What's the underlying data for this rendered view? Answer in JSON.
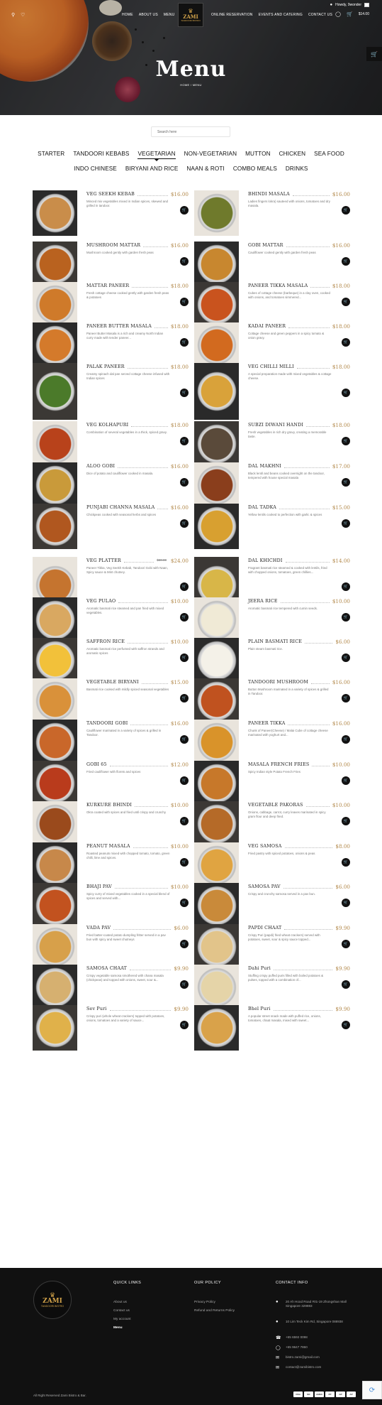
{
  "topbar": {
    "greeting": "Howdy, 9wonder"
  },
  "nav": {
    "left": [
      "HOME",
      "ABOUT US",
      "MENU"
    ],
    "right": [
      "ONLINE RESERVATION",
      "EVENTS AND CATERING",
      "CONTACT US"
    ],
    "cart_total": "$14.00",
    "cart_count": "0"
  },
  "logo": {
    "text": "ZAMI",
    "sub": "TANDOORI BISTRO"
  },
  "hero": {
    "title": "Menu",
    "breadcrumb": "HOME  /  MENU"
  },
  "search": {
    "placeholder": "Search here"
  },
  "tabs_row1": [
    "STARTER",
    "TANDOORI KEBABS",
    "VEGETARIAN",
    "NON-VEGETARIAN",
    "MUTTON",
    "CHICKEN",
    "SEA FOOD"
  ],
  "tabs_row2": [
    "INDO CHINESE",
    "BIRYANI AND RICE",
    "NAAN & ROTI",
    "COMBO MEALS",
    "DRINKS"
  ],
  "active_tab": "VEGETARIAN",
  "items": [
    {
      "name": "VEG SEEKH KEBAB",
      "price": "$16.00",
      "desc": "Minced mix vegetables mixed in Indian spices, skewed and grilled in tandoor.",
      "food": "#c98d4a"
    },
    {
      "name": "BHINDI MASALA",
      "price": "$16.00",
      "desc": "Ladies fingers lokra) sauteed with onions, tomatoes and dry masala.",
      "food": "#6f7a2c"
    },
    {
      "name": "MUSHROOM MATTAR",
      "price": "$16.00",
      "desc": "Mushroom cooked gently with garden fresh peas",
      "food": "#b9621f"
    },
    {
      "name": "GOBI MATTAR",
      "price": "$16.00",
      "desc": "Cauliflower cooked gently with garden fresh peas",
      "food": "#c8872f"
    },
    {
      "name": "MATTAR PANEER",
      "price": "$18.00",
      "desc": "Fresh cottage cheese cooked gently with garden fresh peas & potatoes",
      "food": "#cf7a2a"
    },
    {
      "name": "PANEER TIKKA MASALA",
      "price": "$18.00",
      "desc": "Cubes of cottage cheese (barbeque) in a clay oven, cooked with onions, and tomatoes simmered...",
      "food": "#c9531e"
    },
    {
      "name": "PANEER BUTTER MASALA",
      "price": "$18.00",
      "desc": "Paneer Butter Masala is a rich and creamy North Indian curry made with tender paneer...",
      "food": "#d47a2b"
    },
    {
      "name": "KADAI PANEER",
      "price": "$18.00",
      "desc": "Cottage cheese and green peppers in a spicy tomato & onion gravy.",
      "food": "#d26a1f"
    },
    {
      "name": "PALAK PANEER",
      "price": "$18.00",
      "desc": "Creamy spinach dal pan served cottage cheese infused with Indian spices",
      "food": "#4b7a2a"
    },
    {
      "name": "VEG CHILLI MILLI",
      "price": "$18.00",
      "desc": "A special preparation made with mixed vegetables & cottage cheese.",
      "food": "#d9a23a"
    },
    {
      "name": "VEG KOLHAPURI",
      "price": "$18.00",
      "desc": "Combination of several vegetables in a thick, spiced gravy.",
      "food": "#b8421b"
    },
    {
      "name": "SUBZI DIWANI HANDI",
      "price": "$18.00",
      "desc": "Fresh vegetables in rich dry gravy, creating a memorable taste.",
      "food": "#5a4a3a"
    },
    {
      "name": "ALOO GOBI",
      "price": "$16.00",
      "desc": "Dice of potato and cauliflower cooked in masala.",
      "food": "#c99a3a"
    },
    {
      "name": "DAL MAKHNI",
      "price": "$17.00",
      "desc": "Black lentil and beans cooked overnight on the tandoor, tempered with house special masala",
      "food": "#8a3e1c"
    },
    {
      "name": "PUNJABI CHANNA MASALA",
      "price": "$16.00",
      "desc": "Chickpeas cooked with seasonal herbs and spices",
      "food": "#b0571f"
    },
    {
      "name": "DAL TADKA",
      "price": "$15.00",
      "desc": "Yellow lentils cooked to perfection with garlic & spices",
      "food": "#d8a030"
    },
    {
      "name": "VEG PLATTER",
      "price": "$24.00",
      "old": "$30.00",
      "desc": "Paneer Tikka, Veg Seekh Kebab, Tandoori Gobi with Naan, Spicy sauce & Mint chutney.",
      "food": "#c5742f"
    },
    {
      "name": "DAL KHICHDI",
      "price": "$14.00",
      "desc": "Fragrant basmati rice steamed & cooked with lentils, fried with chopped onions, tomatoes, green chillies...",
      "food": "#d8b648"
    },
    {
      "name": "VEG PULAO",
      "price": "$10.00",
      "desc": "Aromatic basmati rice steamed and pan fried with mixed vegetables.",
      "food": "#d9a861"
    },
    {
      "name": "JEERA RICE",
      "price": "$10.00",
      "desc": "Aromatic basmati rice tempered with cumin seeds.",
      "food": "#f0ead6"
    },
    {
      "name": "SAFFRON RICE",
      "price": "$10.00",
      "desc": "Aromatic basmati rice perfumed with saffron strands and aromatic spices",
      "food": "#f2c13a"
    },
    {
      "name": "PLAIN BASMATI RICE",
      "price": "$6.00",
      "desc": "Plain steam basmati rice.",
      "food": "#f4f1e8"
    },
    {
      "name": "VEGETABLE BIRYANI",
      "price": "$15.00",
      "desc": "Basmati rice cooked with mildly spiced seasonal vegetables",
      "food": "#d9913a"
    },
    {
      "name": "TANDOORI MUSHROOM",
      "price": "$16.00",
      "desc": "Button Mushroom marinated in a variety of spices & grilled in Tandoor.",
      "food": "#c0521f"
    },
    {
      "name": "TANDOORI GOBI",
      "price": "$16.00",
      "desc": "Cauliflower marinated in a variety of spices & grilled in Tandoor.",
      "food": "#c9672a"
    },
    {
      "name": "PANEER TIKKA",
      "price": "$16.00",
      "desc": "Chunk of Paneer(Cheese) / Malai Cube of cottage cheese marinated with yoghurt and...",
      "food": "#d9932a"
    },
    {
      "name": "GOBI 65",
      "price": "$12.00",
      "desc": "Fried cauliflower with florets and spices",
      "food": "#b93b1c"
    },
    {
      "name": "MASALA FRENCH FRIES",
      "price": "$10.00",
      "desc": "Spicy Indian style Potato French Fries",
      "food": "#c7782a"
    },
    {
      "name": "KURKURE BHINDI",
      "price": "$10.00",
      "desc": "Okra coated with spices and fried until crispy and crunchy",
      "food": "#9a4a1c"
    },
    {
      "name": "VEGETABLE PAKORAS",
      "price": "$10.00",
      "desc": "Onions, cabbage, carrot, curry leaves marinated in spicy gram flour and deep fried.",
      "food": "#b56a28"
    },
    {
      "name": "PEANUT MASALA",
      "price": "$10.00",
      "desc": "Roasted peanuts mixed with chopped tomato, tomato, green chilli, lime and spices.",
      "food": "#c7884a"
    },
    {
      "name": "VEG SAMOSA",
      "price": "$8.00",
      "desc": "Fried pastry with spiced potatoes, onions & peas",
      "food": "#e0a441"
    },
    {
      "name": "BHAJI PAV",
      "price": "$10.00",
      "desc": "Spicy curry of mixed vegetables cooked in a special blend of spices and served with...",
      "food": "#c2521f"
    },
    {
      "name": "SAMOSA PAV",
      "price": "$6.00",
      "desc": "Crispy and crunchy samosa served in a pav bun.",
      "food": "#c98a3a"
    },
    {
      "name": "VADA PAV",
      "price": "$6.00",
      "desc": "Fried batter-coated potato dumpling fritter served in a pav bun with spicy and sweet chutneys",
      "food": "#d7a04a"
    },
    {
      "name": "PAPDI CHAAT",
      "price": "$9.90",
      "desc": "Crispy Puri (papdi) fried wheat crackers) served with potatoes, sweet, sour & spicy sauce topped...",
      "food": "#e2c48a"
    },
    {
      "name": "SAMOSA CHAAT",
      "price": "$9.90",
      "desc": "Crispy vegetable samosa smothered with chana masala (chickpeas) and topped with onions, sweet, sour &...",
      "food": "#d6b070"
    },
    {
      "name": "Dahi Puri",
      "price": "$9.90",
      "desc": "Stuffing crispy puffed puris filled with boiled potatoes & pulses, topped with a combination of...",
      "food": "#e5d4a8"
    },
    {
      "name": "Sev Puri",
      "price": "$9.90",
      "desc": "Crispy puri (whole wheat crackers) topped with potatoes, onions, tomatoes and a variety of sauce...",
      "food": "#e0b14a"
    },
    {
      "name": "Bhel Puri",
      "price": "$9.90",
      "desc": "A popular street snack made with puffed rice, onions, tomatoes, chaat masala, mixed with sweet...",
      "food": "#d9a24a"
    }
  ],
  "footer": {
    "quick_links_title": "QUICK LINKS",
    "quick_links": [
      "About us",
      "Contact us",
      "My account",
      "Menu"
    ],
    "policy_title": "OUR POLICY",
    "policy_links": [
      "Privacy Policy",
      "Refund and Returns Policy"
    ],
    "contact_title": "CONTACT INFO",
    "contacts": [
      {
        "icon": "location-icon",
        "text": "20 Ah Hood Road #01-19 Zhongshan Mall Singapore 329983"
      },
      {
        "icon": "location-icon",
        "text": "10 Lim Teck Kim Rd, Singapore 088938"
      },
      {
        "icon": "phone-icon",
        "text": "+65 6592 0098"
      },
      {
        "icon": "whatsapp-icon",
        "text": "+65 9647 7860"
      },
      {
        "icon": "email-icon",
        "text": "bistro.zami@gmail.com"
      },
      {
        "icon": "email-icon",
        "text": "contact@zamibistro.com"
      }
    ],
    "copyright": "All Right Reserved Zami Bistro & Bar.",
    "payments": [
      "VISA",
      "MC",
      "AMEX",
      "PP",
      "GP",
      "AP"
    ]
  }
}
